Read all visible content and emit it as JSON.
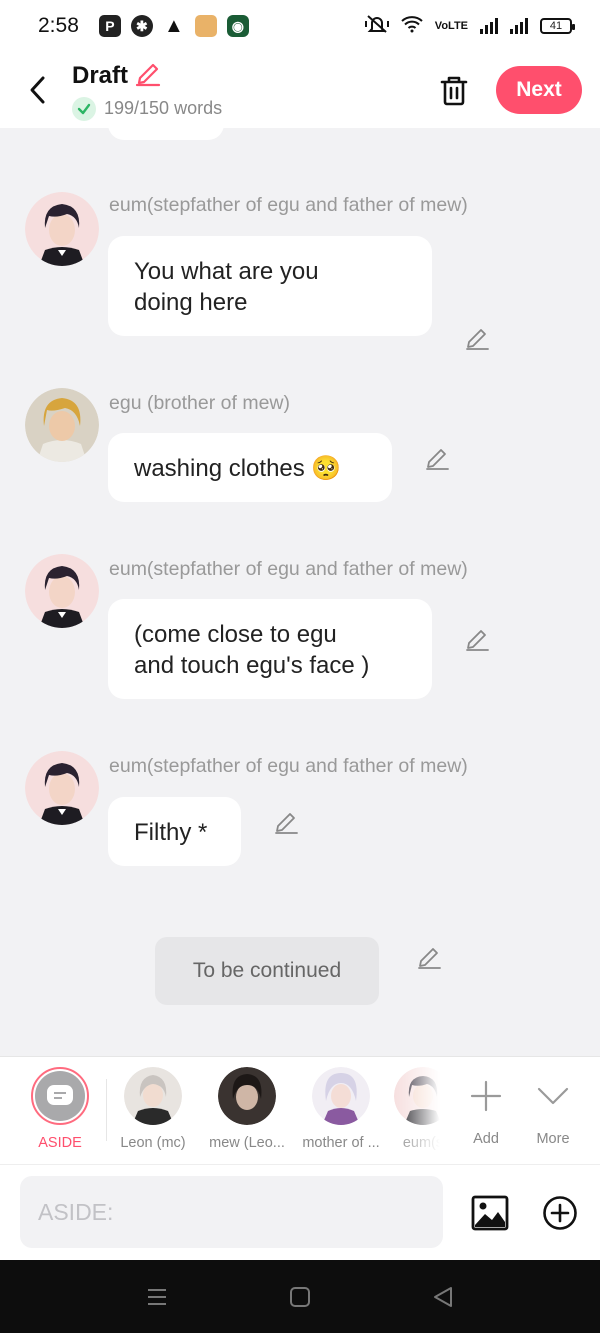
{
  "status_bar": {
    "time": "2:58",
    "network_label": "VoLTE",
    "battery": "41"
  },
  "header": {
    "title": "Draft",
    "word_count": "199/150 words",
    "next_label": "Next"
  },
  "messages": [
    {
      "speaker": "eum(stepfather of egu and father of mew)",
      "text_lines": [
        "You what are you",
        "doing here"
      ]
    },
    {
      "speaker": "egu (brother of mew)",
      "text": "washing clothes 🥺"
    },
    {
      "speaker": "eum(stepfather of egu and father of mew)",
      "text_lines": [
        "(come close to egu",
        "and touch egu's face )"
      ]
    },
    {
      "speaker": "eum(stepfather of egu and father of mew)",
      "text": "Filthy *"
    }
  ],
  "continued_label": "To be continued",
  "characters": [
    {
      "label": "ASIDE"
    },
    {
      "label": "Leon (mc)"
    },
    {
      "label": "mew (Leo..."
    },
    {
      "label": "mother of ..."
    },
    {
      "label": "eum(s"
    }
  ],
  "tools": {
    "add_label": "Add",
    "more_label": "More"
  },
  "input": {
    "placeholder": "ASIDE:"
  },
  "colors": {
    "accent": "#ff4f6d",
    "background": "#f2f2f4",
    "bubble": "#ffffff"
  }
}
